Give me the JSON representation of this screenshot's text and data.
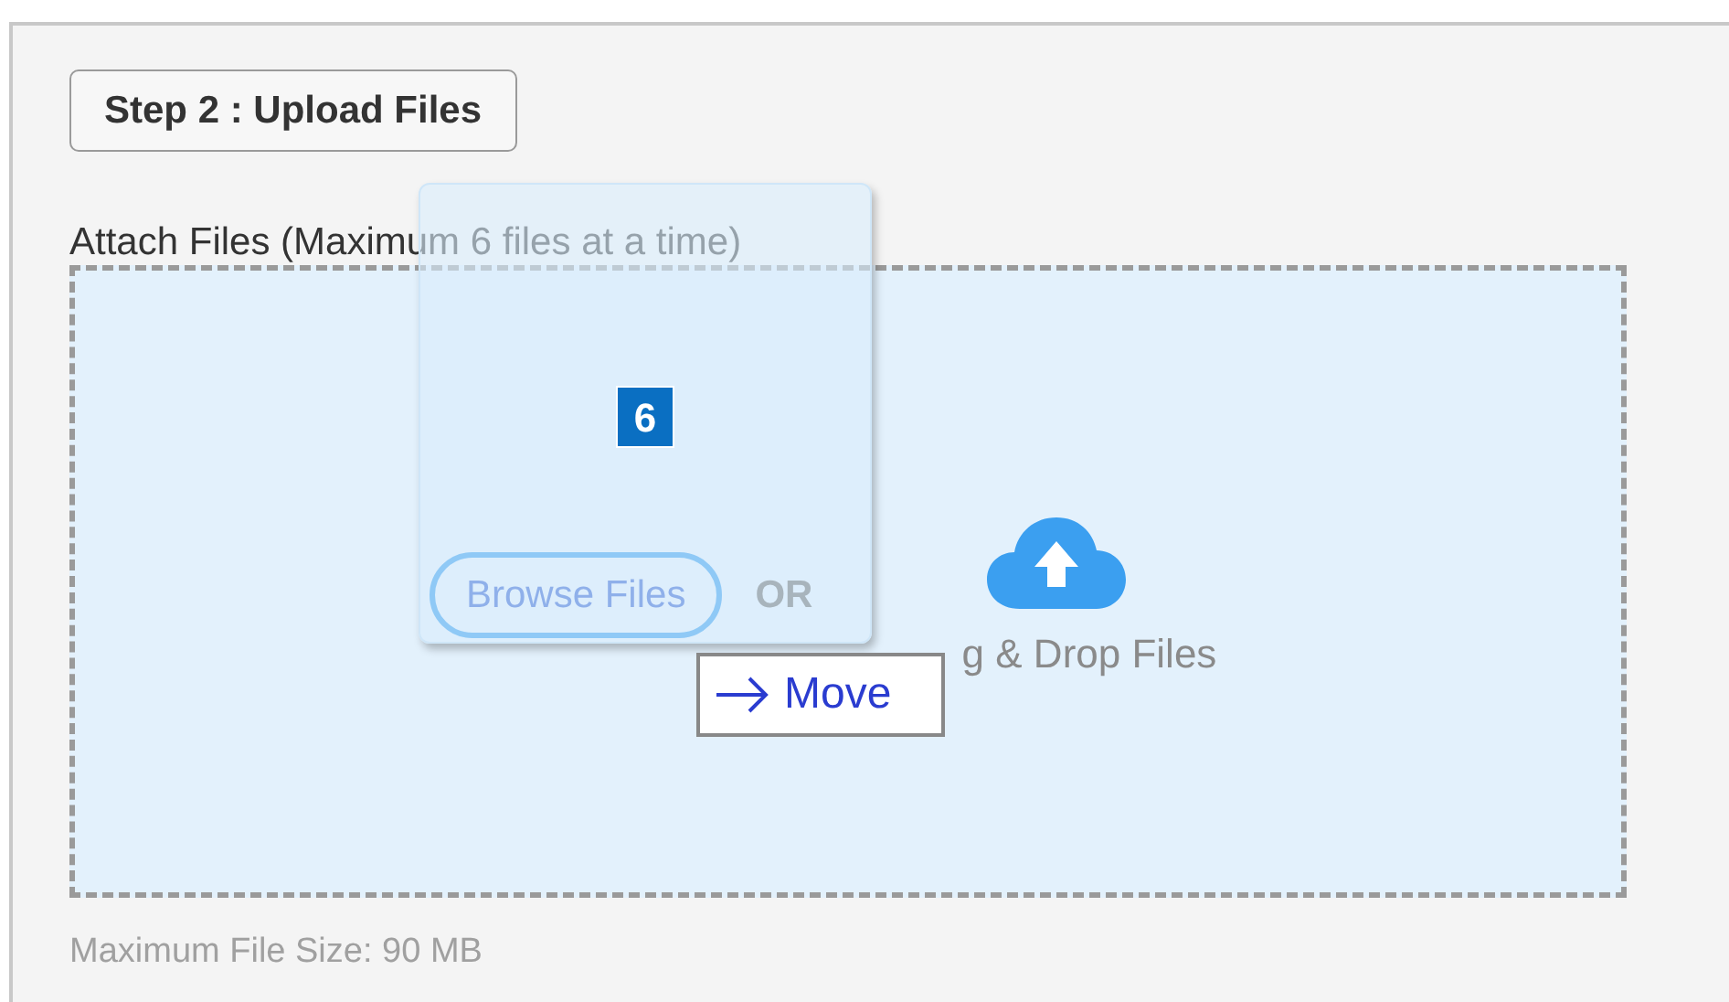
{
  "step_button": "Step 2 : Upload Files",
  "attach_label": "Attach Files (Maximum 6 files at a time)",
  "drop_zone": {
    "text": "g & Drop Files"
  },
  "footer": "Maximum File Size: 90 MB",
  "drag_preview": {
    "count": "6",
    "browse_button": "Browse Files",
    "or_label": "OR"
  },
  "drag_cursor": {
    "label": "Move"
  }
}
